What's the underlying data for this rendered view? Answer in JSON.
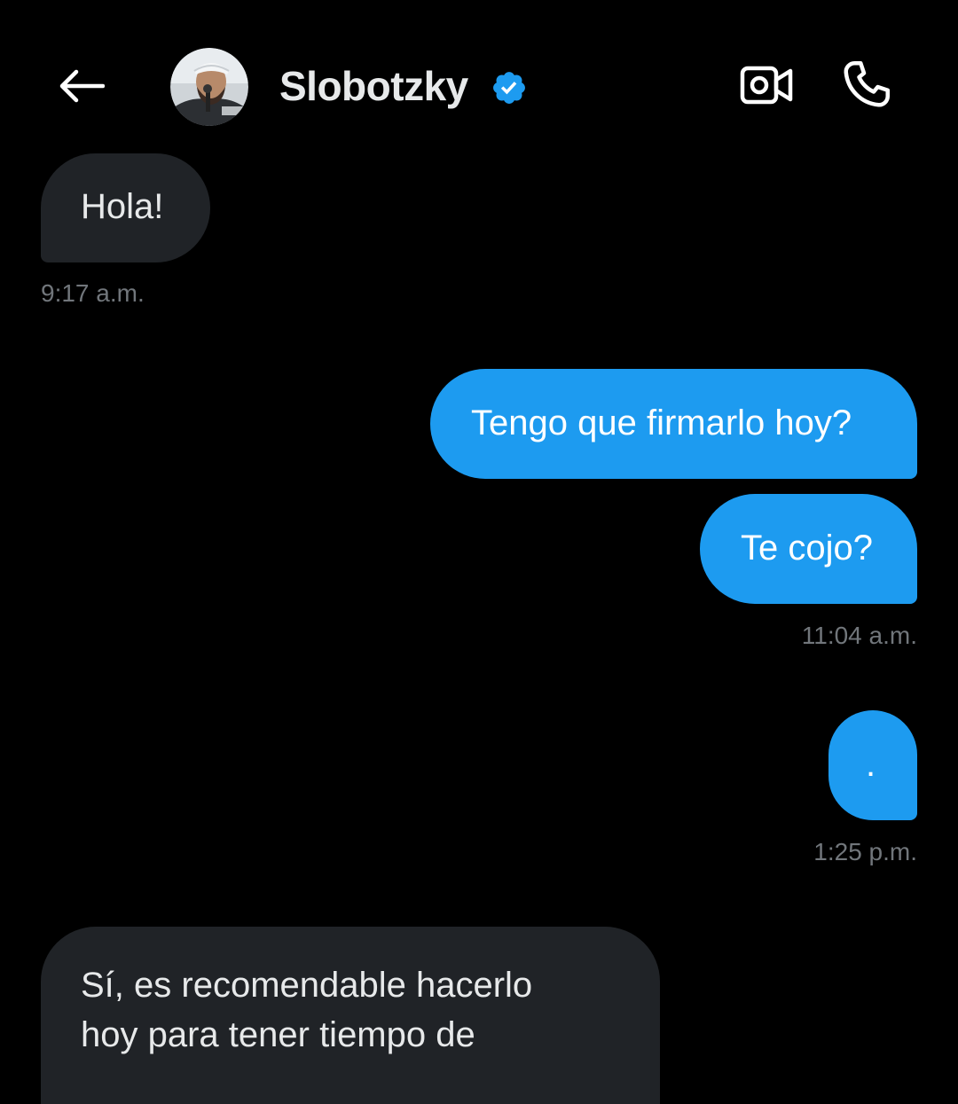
{
  "header": {
    "contact_name": "Slobotzky",
    "verified_color": "#1d9bf0",
    "icons": [
      "back-arrow-icon",
      "verified-badge-icon",
      "video-call-icon",
      "phone-icon"
    ]
  },
  "colors": {
    "background": "#000000",
    "incoming_bubble": "#202327",
    "outgoing_bubble": "#1d9bf0",
    "timestamp": "#71767b"
  },
  "messages": [
    {
      "direction": "incoming",
      "text": "Hola!",
      "time": "9:17 a.m."
    },
    {
      "direction": "outgoing",
      "text": "Tengo que firmarlo hoy?"
    },
    {
      "direction": "outgoing",
      "text": "Te cojo?",
      "time": "11:04 a.m."
    },
    {
      "direction": "outgoing",
      "text": ".",
      "time": "1:25 p.m."
    },
    {
      "direction": "incoming",
      "lines": [
        "Sí, es recomendable hacerlo",
        "hoy para tener tiempo de"
      ]
    }
  ]
}
